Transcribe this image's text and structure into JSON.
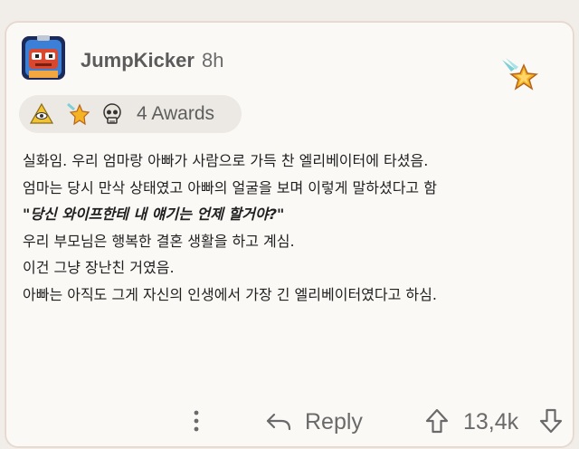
{
  "comment": {
    "username": "JumpKicker",
    "age": "8h",
    "avatar_icon": "robot-avatar-icon",
    "awards": {
      "icons": [
        "pyramid-eye-award-icon",
        "star-award-icon",
        "skull-award-icon"
      ],
      "count_label": "4 Awards",
      "header_award_icon": "shooting-star-award-icon"
    },
    "body": [
      "실화임. 우리 엄마랑 아빠가 사람으로 가득 찬 엘리베이터에 타셨음.",
      "엄마는 당시 만삭 상태였고 아빠의 얼굴을 보며 이렇게 말하셨다고 함",
      "\"당신 와이프한테 내 얘기는 언제 할거야?\"",
      "우리 부모님은 행복한 결혼 생활을 하고 계심.",
      "이건 그냥 장난친 거였음.",
      "아빠는 아직도 그게 자신의 인생에서 가장 긴 엘리베이터였다고 하심."
    ]
  },
  "actions": {
    "more_icon": "vertical-dots-icon",
    "reply_icon": "reply-arrow-icon",
    "reply_label": "Reply",
    "upvote_icon": "upvote-arrow-icon",
    "score": "13,4k",
    "downvote_icon": "downvote-arrow-icon"
  },
  "colors": {
    "background": "#f1eee9",
    "card": "#fbf9f6",
    "star_gold": "#f5b323"
  }
}
